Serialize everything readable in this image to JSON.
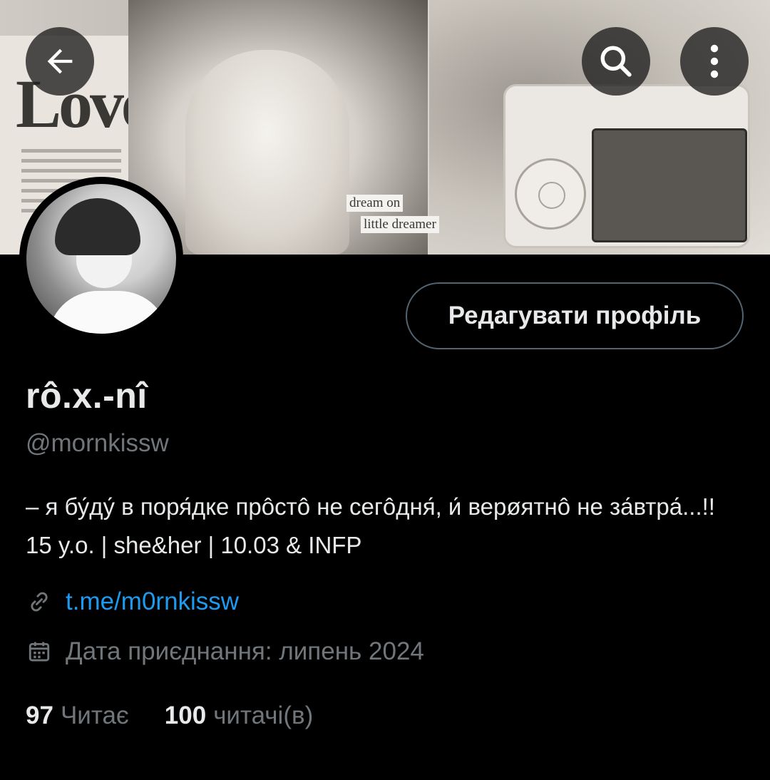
{
  "header": {
    "back_icon": "arrow-left-icon",
    "search_icon": "search-icon",
    "more_icon": "more-vertical-icon",
    "banner_captions": [
      "dream on",
      "little dreamer"
    ],
    "banner_word": "Love"
  },
  "profile": {
    "edit_label": "Редагувати профіль",
    "display_name": "rô.x.-nî",
    "handle": "@mornkissw",
    "bio": "– я бу́ду́ в поря́дке прôстô не сегôдня́, и́ верøятнô не за́втра́...!! 15 y.o. | she&her | 10.03 & INFP",
    "link": "t.me/m0rnkissw",
    "link_icon": "link-icon",
    "joined": "Дата приєднання: липень 2024",
    "calendar_icon": "calendar-icon"
  },
  "stats": {
    "following_count": "97",
    "following_label": "Читає",
    "followers_count": "100",
    "followers_label": "читачі(в)"
  },
  "colors": {
    "background": "#000000",
    "primary_text": "#e7e9ea",
    "secondary_text": "#71767b",
    "link": "#1d9bf0",
    "button_border": "#536471"
  }
}
